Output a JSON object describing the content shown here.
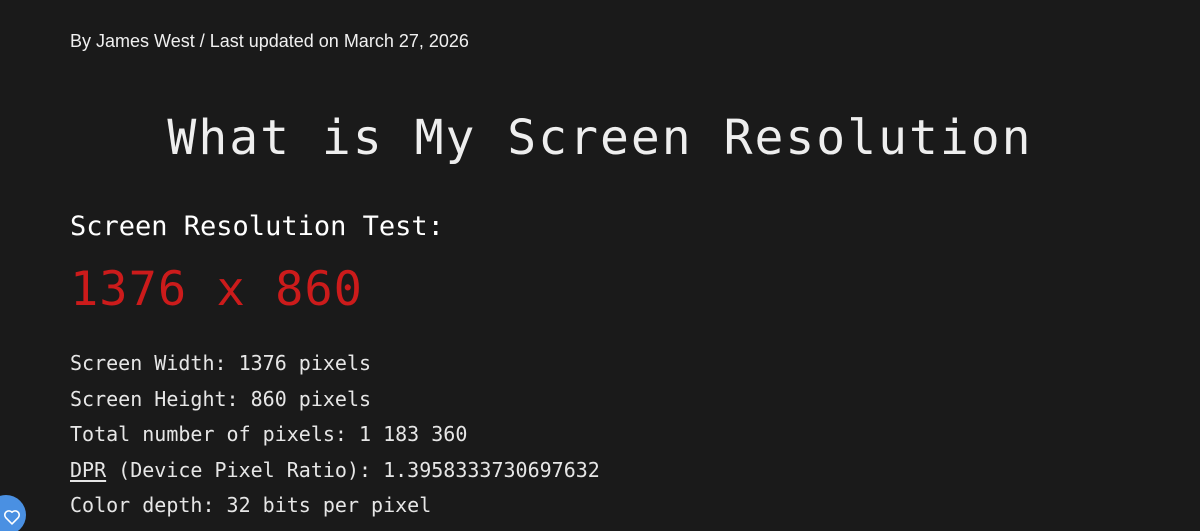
{
  "article": {
    "byline": "By James West / Last updated on March 27, 2026",
    "title": "What is My Screen Resolution"
  },
  "test": {
    "heading": "Screen Resolution Test:",
    "resolution": "1376 x 860",
    "width_label": "Screen Width: ",
    "width_value": "1376 pixels",
    "height_label": "Screen Height: ",
    "height_value": "860 pixels",
    "total_label": "Total number of pixels: ",
    "total_value": "1 183 360",
    "dpr_link": "DPR",
    "dpr_label": " (Device Pixel Ratio): ",
    "dpr_value": "1.3958333730697632",
    "depth_label": "Color depth: ",
    "depth_value": "32 bits per pixel"
  },
  "fab": {
    "icon": "heart-icon"
  },
  "colors": {
    "background": "#1a1a1a",
    "resolution_accent": "#cc1b1b",
    "fab": "#4a90e2"
  }
}
